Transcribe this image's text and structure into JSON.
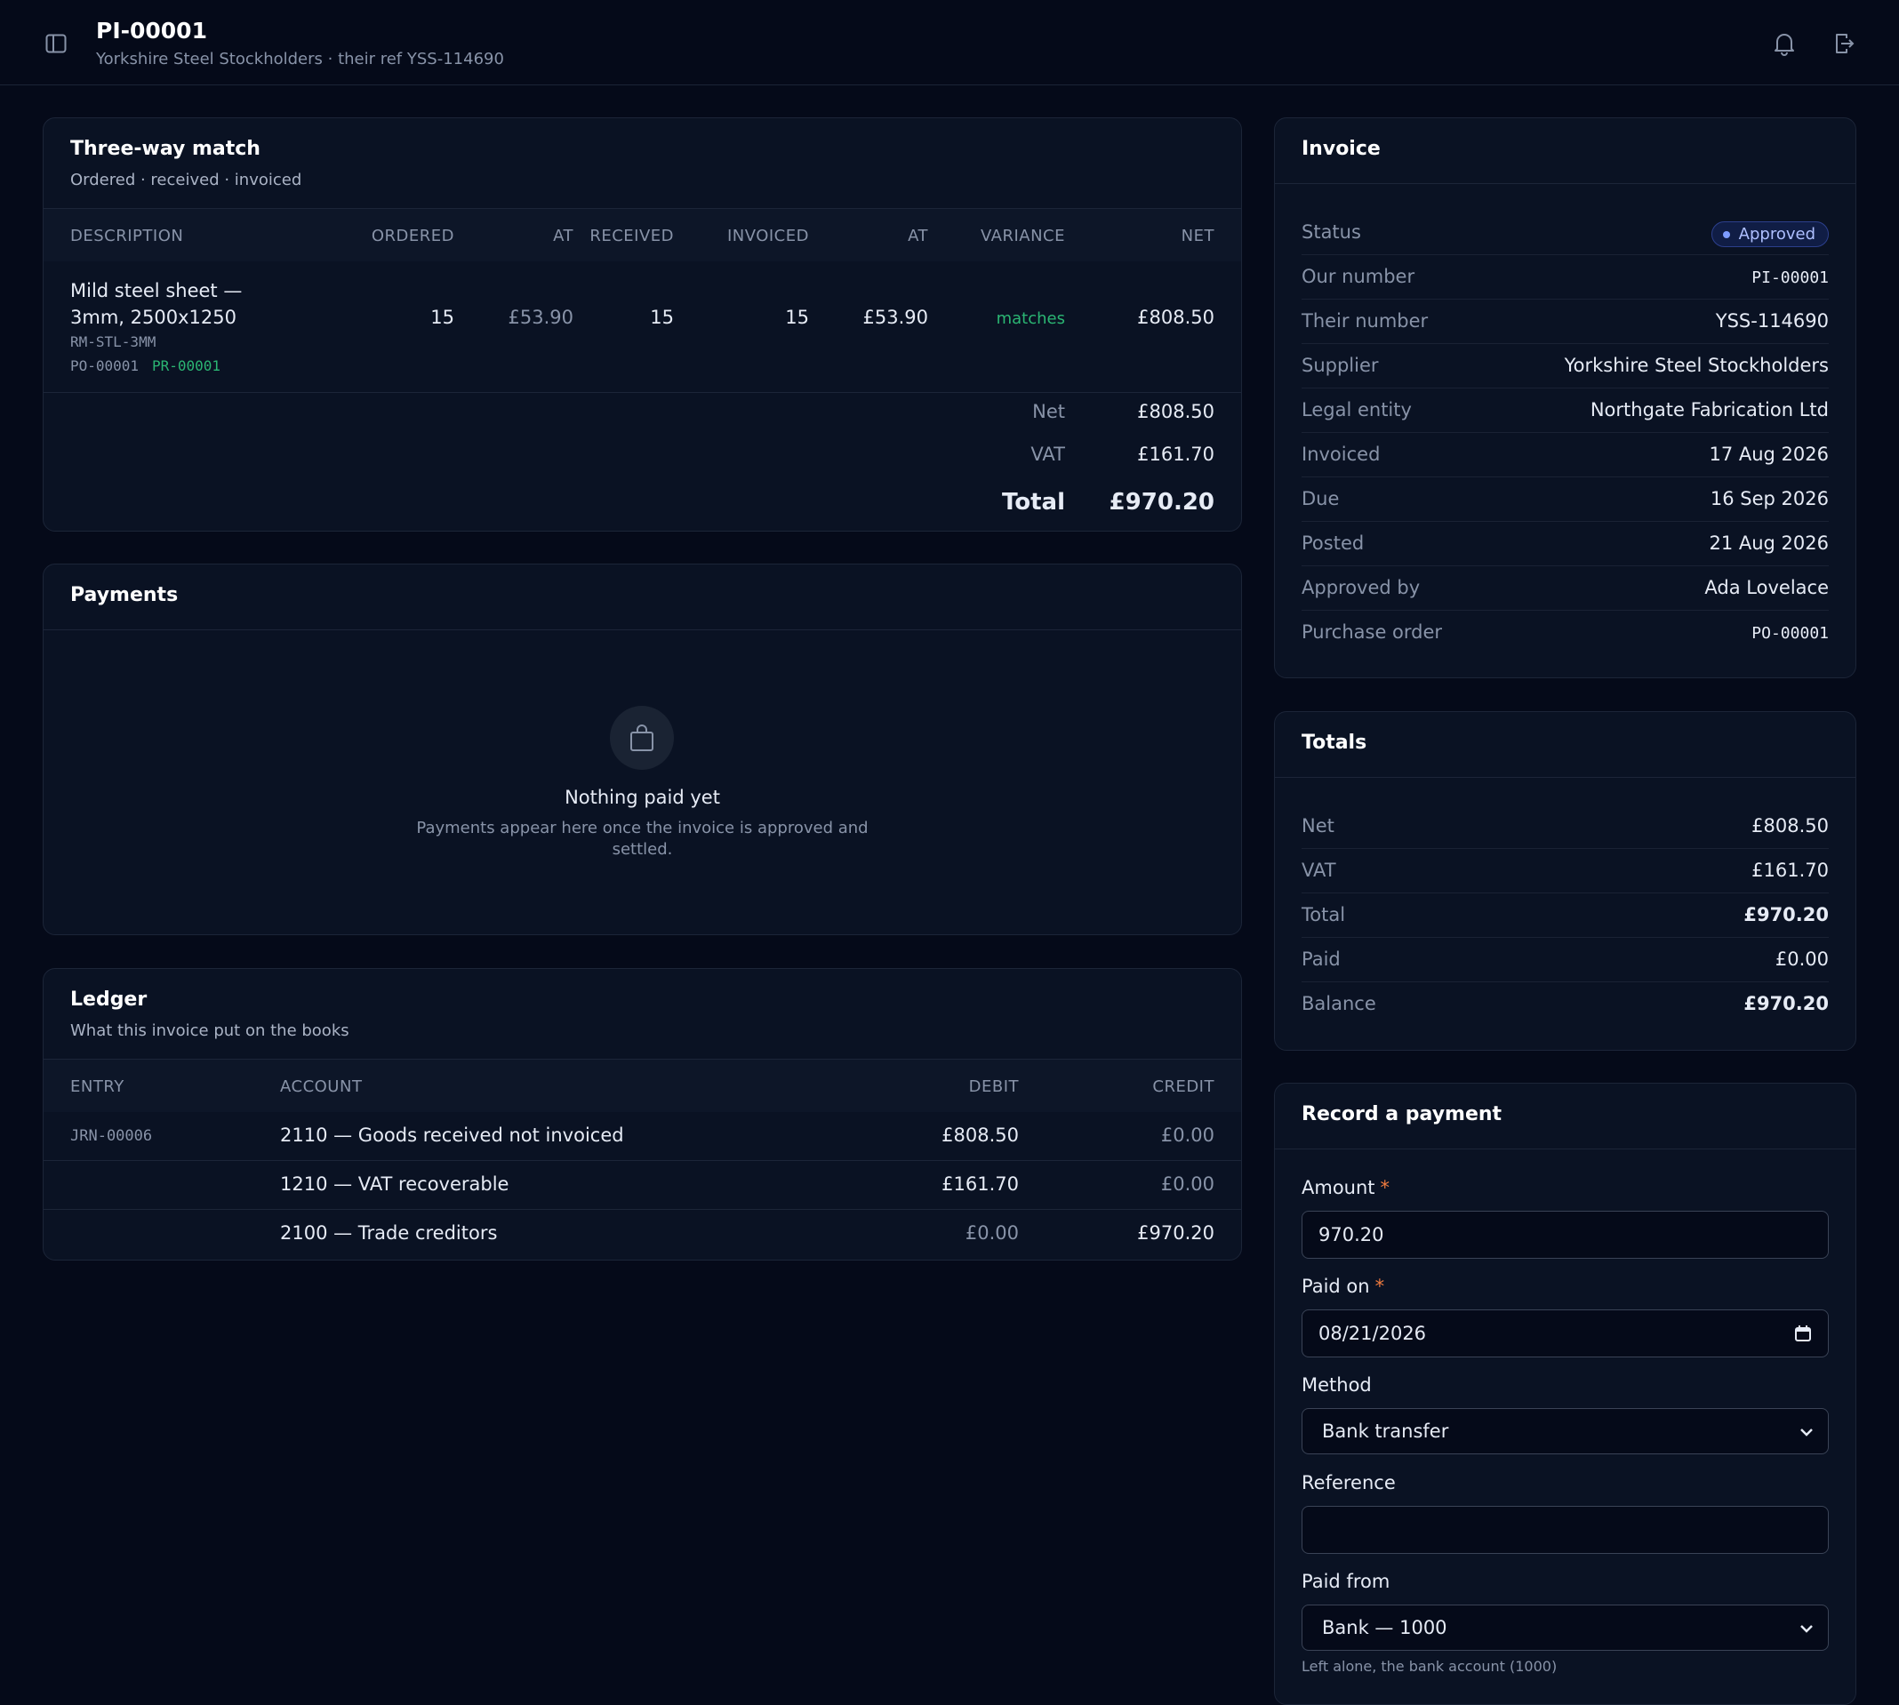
{
  "header": {
    "title": "PI-00001",
    "subtitle": "Yorkshire Steel Stockholders · their ref YSS-114690",
    "icons": [
      "sidebar-toggle-icon",
      "bell-icon",
      "sign-out-icon"
    ]
  },
  "match": {
    "title": "Three-way match",
    "subtitle": "Ordered · received · invoiced",
    "columns": [
      "DESCRIPTION",
      "ORDERED",
      "AT",
      "RECEIVED",
      "INVOICED",
      "AT",
      "VARIANCE",
      "NET"
    ],
    "row": {
      "description_line1": "Mild steel sheet —",
      "description_line2": "3mm, 2500x1250",
      "sku": "RM-STL-3MM",
      "po": "PO-00001",
      "pr": "PR-00001",
      "ordered": "15",
      "ordered_at": "£53.90",
      "received": "15",
      "invoiced": "15",
      "invoiced_at": "£53.90",
      "variance": "matches",
      "net": "£808.50"
    },
    "summary": {
      "net_label": "Net",
      "net": "£808.50",
      "vat_label": "VAT",
      "vat": "£161.70",
      "total_label": "Total",
      "total": "£970.20"
    }
  },
  "payments": {
    "title": "Payments",
    "empty_title": "Nothing paid yet",
    "empty_text_line1": "Payments appear here once the invoice is approved and",
    "empty_text_line2": "settled."
  },
  "ledger": {
    "title": "Ledger",
    "subtitle": "What this invoice put on the books",
    "columns": [
      "ENTRY",
      "ACCOUNT",
      "DEBIT",
      "CREDIT"
    ],
    "rows": [
      {
        "entry": "JRN-00006",
        "account": "2110 — Goods received not invoiced",
        "debit": "£808.50",
        "credit": "£0.00"
      },
      {
        "entry": "",
        "account": "1210 — VAT recoverable",
        "debit": "£161.70",
        "credit": "£0.00"
      },
      {
        "entry": "",
        "account": "2100 — Trade creditors",
        "debit": "£0.00",
        "credit": "£970.20"
      }
    ]
  },
  "invoice": {
    "title": "Invoice",
    "status_label": "Status",
    "status": "Approved",
    "our_number_label": "Our number",
    "our_number": "PI-00001",
    "their_number_label": "Their number",
    "their_number": "YSS-114690",
    "supplier_label": "Supplier",
    "supplier": "Yorkshire Steel Stockholders",
    "legal_entity_label": "Legal entity",
    "legal_entity": "Northgate Fabrication Ltd",
    "invoiced_label": "Invoiced",
    "invoiced": "17 Aug 2026",
    "due_label": "Due",
    "due": "16 Sep 2026",
    "posted_label": "Posted",
    "posted": "21 Aug 2026",
    "approved_by_label": "Approved by",
    "approved_by": "Ada Lovelace",
    "po_label": "Purchase order",
    "po": "PO-00001"
  },
  "totals": {
    "title": "Totals",
    "net_label": "Net",
    "net": "£808.50",
    "vat_label": "VAT",
    "vat": "£161.70",
    "total_label": "Total",
    "total": "£970.20",
    "paid_label": "Paid",
    "paid": "£0.00",
    "balance_label": "Balance",
    "balance": "£970.20"
  },
  "record_payment": {
    "title": "Record a payment",
    "amount_label": "Amount",
    "amount": "970.20",
    "paid_on_label": "Paid on",
    "paid_on": "08/21/2026",
    "method_label": "Method",
    "method": "Bank transfer",
    "reference_label": "Reference",
    "reference": "",
    "paid_from_label": "Paid from",
    "paid_from": "Bank — 1000",
    "hint": "Left alone, the bank account (1000)",
    "required_marker": "*"
  },
  "colors": {
    "background": "#050a19",
    "card": "#0a1223",
    "accent": "#7d9cff",
    "success": "#2bb673",
    "required": "#f07b3f"
  }
}
